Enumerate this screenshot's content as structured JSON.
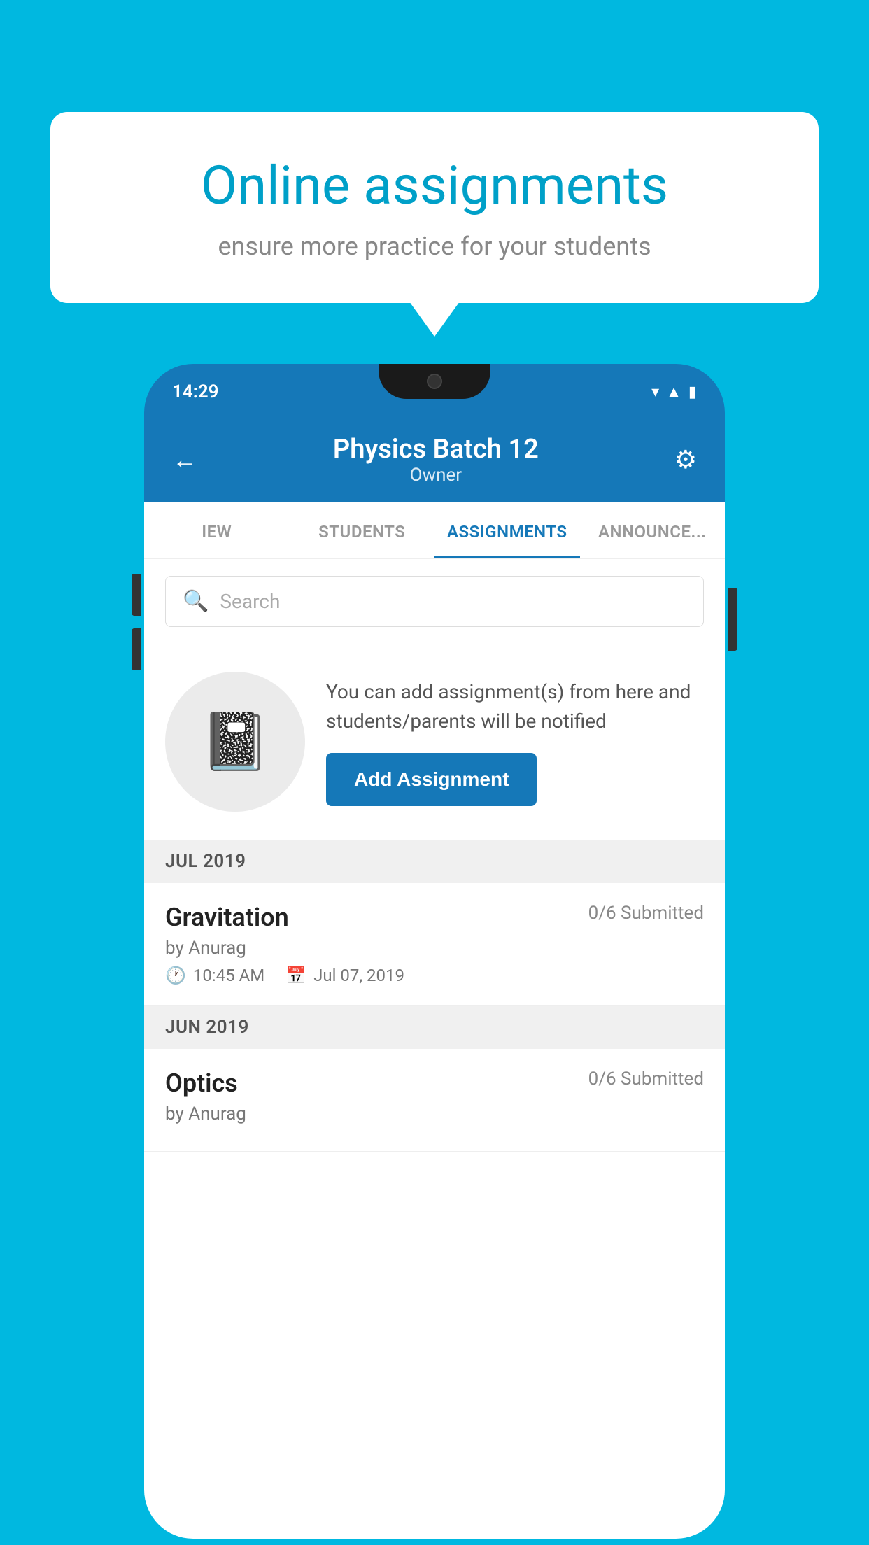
{
  "background_color": "#00B8E0",
  "speech_bubble": {
    "title": "Online assignments",
    "subtitle": "ensure more practice for your students"
  },
  "phone": {
    "status_bar": {
      "time": "14:29",
      "icons": [
        "wifi",
        "signal",
        "battery"
      ]
    },
    "header": {
      "back_label": "←",
      "title": "Physics Batch 12",
      "subtitle": "Owner",
      "settings_label": "⚙"
    },
    "tabs": [
      {
        "label": "IEW",
        "active": false
      },
      {
        "label": "STUDENTS",
        "active": false
      },
      {
        "label": "ASSIGNMENTS",
        "active": true
      },
      {
        "label": "ANNOUNCEMENTS",
        "active": false
      }
    ],
    "search": {
      "placeholder": "Search"
    },
    "promo": {
      "description": "You can add assignment(s) from here and students/parents will be notified",
      "button_label": "Add Assignment"
    },
    "sections": [
      {
        "month_label": "JUL 2019",
        "assignments": [
          {
            "name": "Gravitation",
            "submitted": "0/6 Submitted",
            "by": "by Anurag",
            "time": "10:45 AM",
            "date": "Jul 07, 2019"
          }
        ]
      },
      {
        "month_label": "JUN 2019",
        "assignments": [
          {
            "name": "Optics",
            "submitted": "0/6 Submitted",
            "by": "by Anurag",
            "time": "",
            "date": ""
          }
        ]
      }
    ]
  }
}
